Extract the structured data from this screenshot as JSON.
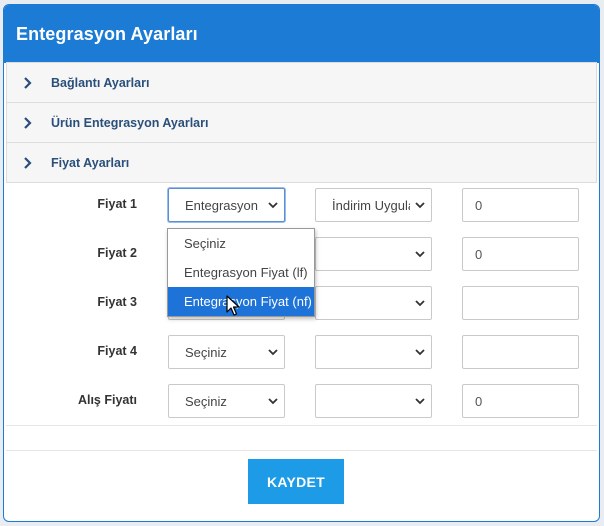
{
  "panel": {
    "title": "Entegrasyon Ayarları"
  },
  "accordion": [
    {
      "label": "Bağlantı Ayarları"
    },
    {
      "label": "Ürün Entegrasyon Ayarları"
    },
    {
      "label": "Fiyat Ayarları"
    }
  ],
  "rows": [
    {
      "label": "Fiyat 1",
      "select1": "Entegrasyon",
      "select2": "İndirim Uygula",
      "input": "0"
    },
    {
      "label": "Fiyat 2",
      "select1": "",
      "select2": "",
      "input": "0"
    },
    {
      "label": "Fiyat 3",
      "select1": "",
      "select2": "",
      "input": ""
    },
    {
      "label": "Fiyat 4",
      "select1": "Seçiniz",
      "select2": "",
      "input": ""
    },
    {
      "label": "Alış Fiyatı",
      "select1": "Seçiniz",
      "select2": "",
      "input": "0"
    }
  ],
  "dropdown": {
    "options": [
      "Seçiniz",
      "Entegrasyon Fiyat (lf)",
      "Entegrasyon Fiyat (nf)"
    ],
    "highlighted_index": 2
  },
  "save_button": {
    "label": "KAYDET"
  },
  "colors": {
    "header": "#1c7bd4",
    "button": "#1e9be6",
    "highlight": "#1e73d8"
  },
  "icons": {
    "accordion": "chevron-right-icon",
    "select": "chevron-down-icon"
  }
}
